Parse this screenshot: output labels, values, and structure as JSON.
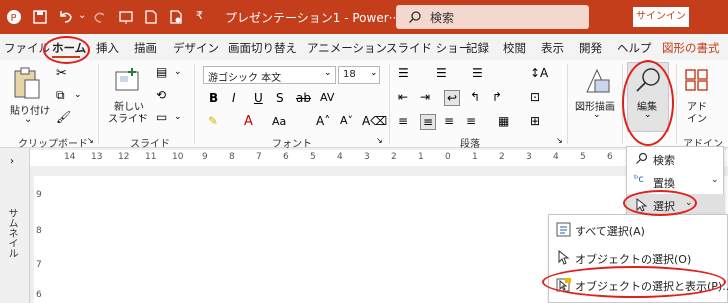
{
  "titlebar": {
    "doc_title": "プレゼンテーション1 - Power···",
    "search_label": "検索",
    "signin_label": "サインイン"
  },
  "menubar": {
    "items": [
      "ファイル",
      "ホーム",
      "挿入",
      "描画",
      "デザイン",
      "画面切り替え",
      "アニメーション",
      "スライド ショー",
      "記録",
      "校閲",
      "表示",
      "開発",
      "ヘルプ",
      "図形の書式"
    ],
    "active": "ホーム"
  },
  "ribbon": {
    "clipboard": {
      "paste_label": "貼り付け",
      "group_label": "クリップボード"
    },
    "slides": {
      "new_slide_label": "新しい スライド",
      "new_slide_line1": "新しい",
      "new_slide_line2": "スライド",
      "group_label": "スライド"
    },
    "font": {
      "font_name": "游ゴシック 本文",
      "font_size": "18",
      "group_label": "フォント"
    },
    "paragraph": {
      "group_label": "段落"
    },
    "drawing": {
      "shape_draw_label": "図形描画"
    },
    "editing": {
      "edit_label": "編集",
      "addin_label": "アド イン",
      "addin_line1": "アド",
      "addin_line2": "イン",
      "addin_group": "アドイン"
    }
  },
  "thumbnails": {
    "label": "サムネイル"
  },
  "hruler_ticks": [
    "14",
    "13",
    "12",
    "11",
    "10",
    "9",
    "8",
    "7",
    "6",
    "5",
    "4",
    "3",
    "2",
    "1",
    "0",
    "1",
    "2",
    "3",
    "4",
    "5",
    "6",
    "7",
    "8"
  ],
  "vruler_ticks": [
    "9",
    "8",
    "7",
    "6"
  ],
  "edit_dropdown": {
    "find_label": "検索",
    "replace_label": "置換",
    "select_label": "選択"
  },
  "select_submenu": {
    "items": [
      "すべて選択(A)",
      "オブジェクトの選択(O)",
      "オブジェクトの選択と表示(P)..."
    ]
  },
  "colors": {
    "accent": "#c43e1c",
    "annotation": "#e0201b"
  }
}
